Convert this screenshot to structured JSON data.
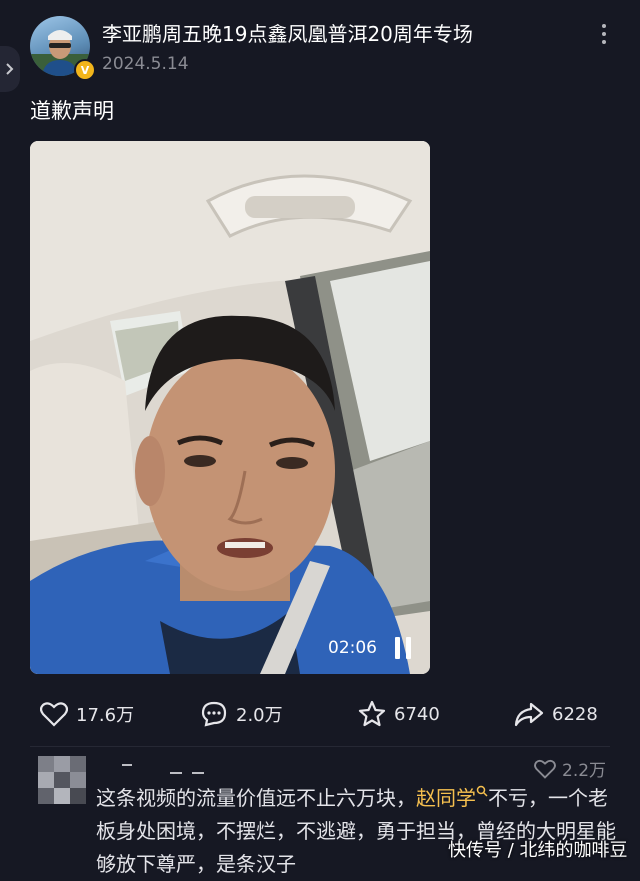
{
  "post": {
    "title": "李亚鹏周五晚19点鑫凤凰普洱20周年专场",
    "date": "2024.5.14",
    "caption": "道歉声明",
    "verified_badge": "V",
    "accent_badge_color": "#f2b51b"
  },
  "video": {
    "time": "02:06",
    "state": "playing"
  },
  "actions": {
    "likes": "17.6万",
    "comments": "2.0万",
    "favorites": "6740",
    "shares": "6228"
  },
  "comment": {
    "likes": "2.2万",
    "text_before": "这条视频的流量价值远不止六万块，",
    "mention": "赵同学",
    "text_after": "不亏，一个老板身处困境，不摆烂，不逃避，勇于担当，曾经的大明星能够放下尊严，是条汉子",
    "mention_color": "#f6c04f"
  },
  "watermark": "快传号 / 北纬的咖啡豆",
  "icons": [
    "chevron-right-icon",
    "more-vertical-icon",
    "heart-icon",
    "comment-icon",
    "star-icon",
    "share-icon",
    "search-icon",
    "pause-icon"
  ],
  "colors": {
    "background": "#161823",
    "secondary_text": "#8a8b93"
  }
}
